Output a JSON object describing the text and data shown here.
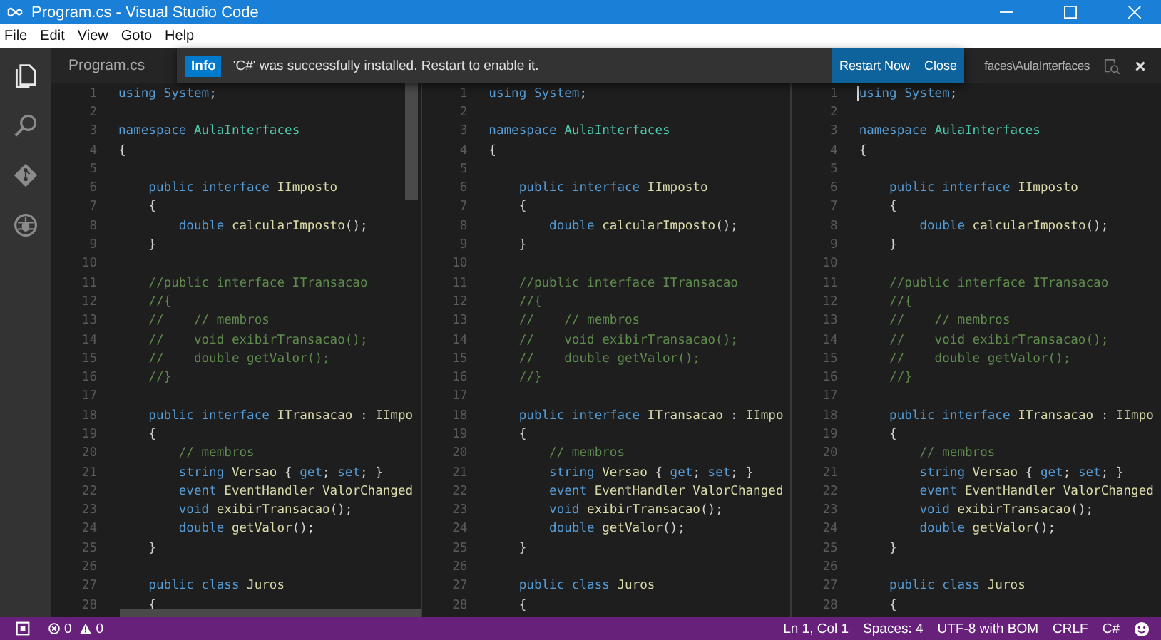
{
  "window": {
    "title": "Program.cs - Visual Studio Code"
  },
  "menu": [
    "File",
    "Edit",
    "View",
    "Goto",
    "Help"
  ],
  "activity_bar": [
    {
      "kind": "explorer",
      "selected": true
    },
    {
      "kind": "search",
      "selected": false
    },
    {
      "kind": "git",
      "selected": false
    },
    {
      "kind": "debug",
      "selected": false
    }
  ],
  "notification": {
    "badge": "Info",
    "message": "'C#' was successfully installed. Restart to enable it.",
    "actions": [
      "Restart Now",
      "Close"
    ]
  },
  "panes": [
    {
      "tab": "Program.cs",
      "lines": [
        {
          "n": "1",
          "tokens": [
            {
              "kind": "keyword",
              "text": "using System"
            },
            {
              "kind": "text",
              "text": ";"
            }
          ]
        },
        {
          "n": "2"
        },
        {
          "n": "3",
          "tokens": [
            {
              "kind": "keyword",
              "text": "namespace "
            },
            {
              "kind": "namespace",
              "text": "AulaInterfaces"
            }
          ]
        },
        {
          "n": "4",
          "tokens": [
            {
              "kind": "text",
              "text": "{"
            }
          ]
        },
        {
          "n": "5"
        },
        {
          "n": "6",
          "tokens": [
            {
              "kind": "keyword",
              "text": "    public interface "
            },
            {
              "kind": "type",
              "text": "IImposto"
            }
          ]
        },
        {
          "n": "7",
          "tokens": [
            {
              "kind": "text",
              "text": "    {"
            }
          ]
        },
        {
          "n": "8",
          "tokens": [
            {
              "kind": "keyword",
              "text": "        double "
            },
            {
              "kind": "function",
              "text": "calcularImposto"
            },
            {
              "kind": "text",
              "text": "();"
            }
          ]
        },
        {
          "n": "9",
          "tokens": [
            {
              "kind": "text",
              "text": "    }"
            }
          ]
        },
        {
          "n": "10"
        },
        {
          "n": "11",
          "tokens": [
            {
              "kind": "comment",
              "text": "    //public interface ITransacao"
            }
          ]
        },
        {
          "n": "12",
          "tokens": [
            {
              "kind": "comment",
              "text": "    //{"
            }
          ]
        },
        {
          "n": "13",
          "tokens": [
            {
              "kind": "comment",
              "text": "    //    // membros"
            }
          ]
        },
        {
          "n": "14",
          "tokens": [
            {
              "kind": "comment",
              "text": "    //    void exibirTransacao();"
            }
          ]
        },
        {
          "n": "15",
          "tokens": [
            {
              "kind": "comment",
              "text": "    //    double getValor();"
            }
          ]
        },
        {
          "n": "16",
          "tokens": [
            {
              "kind": "comment",
              "text": "    //}"
            }
          ]
        },
        {
          "n": "17"
        },
        {
          "n": "18",
          "tokens": [
            {
              "kind": "keyword",
              "text": "    public interface "
            },
            {
              "kind": "type",
              "text": "ITransacao"
            },
            {
              "kind": "text",
              "text": " : "
            },
            {
              "kind": "type",
              "text": "IImpo"
            }
          ]
        },
        {
          "n": "19",
          "tokens": [
            {
              "kind": "text",
              "text": "    {"
            }
          ]
        },
        {
          "n": "20",
          "tokens": [
            {
              "kind": "comment",
              "text": "        // membros"
            }
          ]
        },
        {
          "n": "21",
          "tokens": [
            {
              "kind": "keyword",
              "text": "        string "
            },
            {
              "kind": "function",
              "text": "Versao"
            },
            {
              "kind": "text",
              "text": " { "
            },
            {
              "kind": "keyword",
              "text": "get"
            },
            {
              "kind": "text",
              "text": "; "
            },
            {
              "kind": "keyword",
              "text": "set"
            },
            {
              "kind": "text",
              "text": "; }"
            }
          ]
        },
        {
          "n": "22",
          "tokens": [
            {
              "kind": "keyword",
              "text": "        event "
            },
            {
              "kind": "type",
              "text": "EventHandler"
            },
            {
              "kind": "function",
              "text": " ValorChanged"
            }
          ]
        },
        {
          "n": "23",
          "tokens": [
            {
              "kind": "keyword",
              "text": "        void "
            },
            {
              "kind": "function",
              "text": "exibirTransacao"
            },
            {
              "kind": "text",
              "text": "();"
            }
          ]
        },
        {
          "n": "24",
          "tokens": [
            {
              "kind": "keyword",
              "text": "        double "
            },
            {
              "kind": "function",
              "text": "getValor"
            },
            {
              "kind": "text",
              "text": "();"
            }
          ]
        },
        {
          "n": "25",
          "tokens": [
            {
              "kind": "text",
              "text": "    }"
            }
          ]
        },
        {
          "n": "26"
        },
        {
          "n": "27",
          "tokens": [
            {
              "kind": "keyword",
              "text": "    public class "
            },
            {
              "kind": "type",
              "text": "Juros"
            }
          ]
        },
        {
          "n": "28",
          "tokens": [
            {
              "kind": "text",
              "text": "    {"
            }
          ]
        }
      ]
    },
    {
      "lines": [
        {
          "n": "1",
          "tokens": [
            {
              "kind": "keyword",
              "text": "using System"
            },
            {
              "kind": "text",
              "text": ";"
            }
          ]
        },
        {
          "n": "2"
        },
        {
          "n": "3",
          "tokens": [
            {
              "kind": "keyword",
              "text": "namespace "
            },
            {
              "kind": "namespace",
              "text": "AulaInterfaces"
            }
          ]
        },
        {
          "n": "4",
          "tokens": [
            {
              "kind": "text",
              "text": "{"
            }
          ]
        },
        {
          "n": "5"
        },
        {
          "n": "6",
          "tokens": [
            {
              "kind": "keyword",
              "text": "    public interface "
            },
            {
              "kind": "type",
              "text": "IImposto"
            }
          ]
        },
        {
          "n": "7",
          "tokens": [
            {
              "kind": "text",
              "text": "    {"
            }
          ]
        },
        {
          "n": "8",
          "tokens": [
            {
              "kind": "keyword",
              "text": "        double "
            },
            {
              "kind": "function",
              "text": "calcularImposto"
            },
            {
              "kind": "text",
              "text": "();"
            }
          ]
        },
        {
          "n": "9",
          "tokens": [
            {
              "kind": "text",
              "text": "    }"
            }
          ]
        },
        {
          "n": "10"
        },
        {
          "n": "11",
          "tokens": [
            {
              "kind": "comment",
              "text": "    //public interface ITransacao"
            }
          ]
        },
        {
          "n": "12",
          "tokens": [
            {
              "kind": "comment",
              "text": "    //{"
            }
          ]
        },
        {
          "n": "13",
          "tokens": [
            {
              "kind": "comment",
              "text": "    //    // membros"
            }
          ]
        },
        {
          "n": "14",
          "tokens": [
            {
              "kind": "comment",
              "text": "    //    void exibirTransacao();"
            }
          ]
        },
        {
          "n": "15",
          "tokens": [
            {
              "kind": "comment",
              "text": "    //    double getValor();"
            }
          ]
        },
        {
          "n": "16",
          "tokens": [
            {
              "kind": "comment",
              "text": "    //}"
            }
          ]
        },
        {
          "n": "17"
        },
        {
          "n": "18",
          "tokens": [
            {
              "kind": "keyword",
              "text": "    public interface "
            },
            {
              "kind": "type",
              "text": "ITransacao"
            },
            {
              "kind": "text",
              "text": " : "
            },
            {
              "kind": "type",
              "text": "IImpo"
            }
          ]
        },
        {
          "n": "19",
          "tokens": [
            {
              "kind": "text",
              "text": "    {"
            }
          ]
        },
        {
          "n": "20",
          "tokens": [
            {
              "kind": "comment",
              "text": "        // membros"
            }
          ]
        },
        {
          "n": "21",
          "tokens": [
            {
              "kind": "keyword",
              "text": "        string "
            },
            {
              "kind": "function",
              "text": "Versao"
            },
            {
              "kind": "text",
              "text": " { "
            },
            {
              "kind": "keyword",
              "text": "get"
            },
            {
              "kind": "text",
              "text": "; "
            },
            {
              "kind": "keyword",
              "text": "set"
            },
            {
              "kind": "text",
              "text": "; }"
            }
          ]
        },
        {
          "n": "22",
          "tokens": [
            {
              "kind": "keyword",
              "text": "        event "
            },
            {
              "kind": "type",
              "text": "EventHandler"
            },
            {
              "kind": "function",
              "text": " ValorChanged"
            }
          ]
        },
        {
          "n": "23",
          "tokens": [
            {
              "kind": "keyword",
              "text": "        void "
            },
            {
              "kind": "function",
              "text": "exibirTransacao"
            },
            {
              "kind": "text",
              "text": "();"
            }
          ]
        },
        {
          "n": "24",
          "tokens": [
            {
              "kind": "keyword",
              "text": "        double "
            },
            {
              "kind": "function",
              "text": "getValor"
            },
            {
              "kind": "text",
              "text": "();"
            }
          ]
        },
        {
          "n": "25",
          "tokens": [
            {
              "kind": "text",
              "text": "    }"
            }
          ]
        },
        {
          "n": "26"
        },
        {
          "n": "27",
          "tokens": [
            {
              "kind": "keyword",
              "text": "    public class "
            },
            {
              "kind": "type",
              "text": "Juros"
            }
          ]
        },
        {
          "n": "28",
          "tokens": [
            {
              "kind": "text",
              "text": "    {"
            }
          ]
        }
      ]
    },
    {
      "path": "faces\\AulaInterfaces",
      "cursor": true,
      "lines": [
        {
          "n": "1",
          "tokens": [
            {
              "kind": "keyword",
              "text": "using System"
            },
            {
              "kind": "text",
              "text": ";"
            }
          ]
        },
        {
          "n": "2"
        },
        {
          "n": "3",
          "tokens": [
            {
              "kind": "keyword",
              "text": "namespace "
            },
            {
              "kind": "namespace",
              "text": "AulaInterfaces"
            }
          ]
        },
        {
          "n": "4",
          "tokens": [
            {
              "kind": "text",
              "text": "{"
            }
          ]
        },
        {
          "n": "5"
        },
        {
          "n": "6",
          "tokens": [
            {
              "kind": "keyword",
              "text": "    public interface "
            },
            {
              "kind": "type",
              "text": "IImposto"
            }
          ]
        },
        {
          "n": "7",
          "tokens": [
            {
              "kind": "text",
              "text": "    {"
            }
          ]
        },
        {
          "n": "8",
          "tokens": [
            {
              "kind": "keyword",
              "text": "        double "
            },
            {
              "kind": "function",
              "text": "calcularImposto"
            },
            {
              "kind": "text",
              "text": "();"
            }
          ]
        },
        {
          "n": "9",
          "tokens": [
            {
              "kind": "text",
              "text": "    }"
            }
          ]
        },
        {
          "n": "10"
        },
        {
          "n": "11",
          "tokens": [
            {
              "kind": "comment",
              "text": "    //public interface ITransacao"
            }
          ]
        },
        {
          "n": "12",
          "tokens": [
            {
              "kind": "comment",
              "text": "    //{"
            }
          ]
        },
        {
          "n": "13",
          "tokens": [
            {
              "kind": "comment",
              "text": "    //    // membros"
            }
          ]
        },
        {
          "n": "14",
          "tokens": [
            {
              "kind": "comment",
              "text": "    //    void exibirTransacao();"
            }
          ]
        },
        {
          "n": "15",
          "tokens": [
            {
              "kind": "comment",
              "text": "    //    double getValor();"
            }
          ]
        },
        {
          "n": "16",
          "tokens": [
            {
              "kind": "comment",
              "text": "    //}"
            }
          ]
        },
        {
          "n": "17"
        },
        {
          "n": "18",
          "tokens": [
            {
              "kind": "keyword",
              "text": "    public interface "
            },
            {
              "kind": "type",
              "text": "ITransacao"
            },
            {
              "kind": "text",
              "text": " : "
            },
            {
              "kind": "type",
              "text": "IImpo"
            }
          ]
        },
        {
          "n": "19",
          "tokens": [
            {
              "kind": "text",
              "text": "    {"
            }
          ]
        },
        {
          "n": "20",
          "tokens": [
            {
              "kind": "comment",
              "text": "        // membros"
            }
          ]
        },
        {
          "n": "21",
          "tokens": [
            {
              "kind": "keyword",
              "text": "        string "
            },
            {
              "kind": "function",
              "text": "Versao"
            },
            {
              "kind": "text",
              "text": " { "
            },
            {
              "kind": "keyword",
              "text": "get"
            },
            {
              "kind": "text",
              "text": "; "
            },
            {
              "kind": "keyword",
              "text": "set"
            },
            {
              "kind": "text",
              "text": "; }"
            }
          ]
        },
        {
          "n": "22",
          "tokens": [
            {
              "kind": "keyword",
              "text": "        event "
            },
            {
              "kind": "type",
              "text": "EventHandler"
            },
            {
              "kind": "function",
              "text": " ValorChanged"
            }
          ]
        },
        {
          "n": "23",
          "tokens": [
            {
              "kind": "keyword",
              "text": "        void "
            },
            {
              "kind": "function",
              "text": "exibirTransacao"
            },
            {
              "kind": "text",
              "text": "();"
            }
          ]
        },
        {
          "n": "24",
          "tokens": [
            {
              "kind": "keyword",
              "text": "        double "
            },
            {
              "kind": "function",
              "text": "getValor"
            },
            {
              "kind": "text",
              "text": "();"
            }
          ]
        },
        {
          "n": "25",
          "tokens": [
            {
              "kind": "text",
              "text": "    }"
            }
          ]
        },
        {
          "n": "26"
        },
        {
          "n": "27",
          "tokens": [
            {
              "kind": "keyword",
              "text": "    public class "
            },
            {
              "kind": "type",
              "text": "Juros"
            }
          ]
        },
        {
          "n": "28",
          "tokens": [
            {
              "kind": "text",
              "text": "    {"
            }
          ]
        }
      ]
    }
  ],
  "status_bar": {
    "problems": [
      {
        "kind": "error",
        "count": "0"
      },
      {
        "kind": "warning",
        "count": "0"
      }
    ],
    "items": [
      "Ln 1, Col 1",
      "Spaces: 4",
      "UTF-8 with BOM",
      "CRLF",
      "C#"
    ]
  }
}
